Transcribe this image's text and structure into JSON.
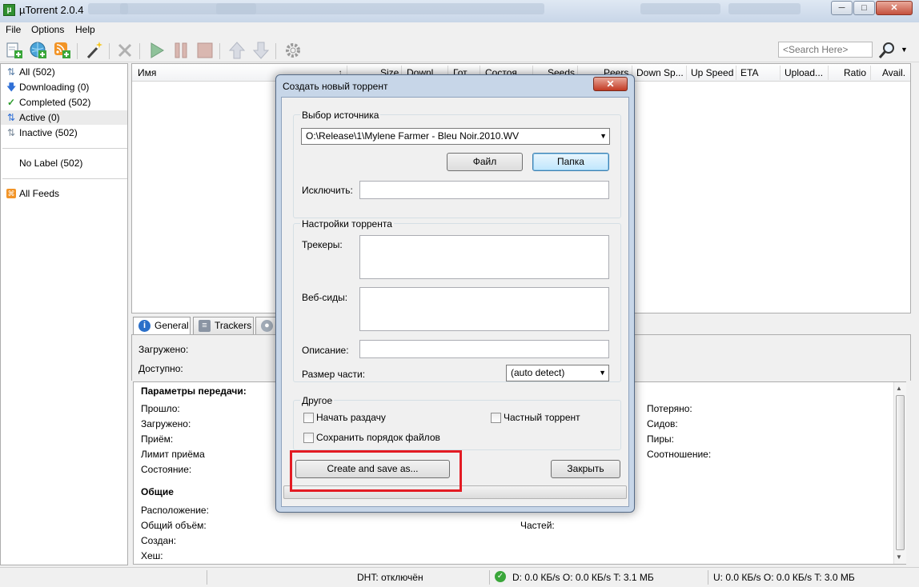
{
  "app": {
    "title": "µTorrent 2.0.4",
    "icon_glyph": "µ"
  },
  "menu": [
    "File",
    "Options",
    "Help"
  ],
  "toolbar": {
    "buttons": [
      "add-torrent-icon",
      "add-url-icon",
      "add-rss-icon",
      "create-torrent-wand-icon",
      "remove-icon",
      "start-icon",
      "pause-icon",
      "stop-icon",
      "move-up-icon",
      "move-down-icon",
      "preferences-gear-icon"
    ],
    "search_placeholder": "<Search Here>"
  },
  "sidebar": {
    "items": [
      {
        "label": "All (502)",
        "icon": "all-icon"
      },
      {
        "label": "Downloading (0)",
        "icon": "download-arrow-icon"
      },
      {
        "label": "Completed (502)",
        "icon": "checkmark-icon"
      },
      {
        "label": "Active (0)",
        "icon": "active-arrows-icon"
      },
      {
        "label": "Inactive (502)",
        "icon": "inactive-arrows-icon"
      }
    ],
    "labels_item": "No Label (502)",
    "feeds_item": "All Feeds"
  },
  "list": {
    "columns": [
      "Имя",
      "Size",
      "Downl...",
      "Гот...",
      "Состоя...",
      "Seeds",
      "Peers",
      "Down Sp...",
      "Up Speed",
      "ETA",
      "Upload...",
      "Ratio",
      "Avail."
    ]
  },
  "detail": {
    "tabs": [
      "General",
      "Trackers"
    ],
    "downloaded_label": "Загружено:",
    "available_label": "Доступно:",
    "transfer_header": "Параметры передачи:",
    "transfer_left": [
      "Прошло:",
      "Загружено:",
      "Приём:",
      "Лимит приёма",
      "Состояние:"
    ],
    "transfer_right": [
      "Потеряно:",
      "Сидов:",
      "Пиры:",
      "Соотношение:"
    ],
    "general_header": "Общие",
    "general_left": [
      "Расположение:",
      "Общий объём:",
      "Создан:",
      "Хеш:"
    ],
    "pieces_label": "Частей:"
  },
  "status": {
    "dht": "DHT: отключён",
    "download": "D: 0.0 КБ/s O: 0.0 КБ/s T: 3.1 МБ",
    "upload": "U: 0.0 КБ/s O: 0.0 КБ/s T: 3.0 МБ"
  },
  "dialog": {
    "title": "Создать новый торрент",
    "source_group": "Выбор источника",
    "source_path": "O:\\Release\\1\\Mylene Farmer - Bleu Noir.2010.WV",
    "file_button": "Файл",
    "folder_button": "Папка",
    "exclude_label": "Исключить:",
    "exclude_value": "",
    "settings_group": "Настройки торрента",
    "trackers_label": "Трекеры:",
    "trackers_value": "",
    "webseeds_label": "Веб-сиды:",
    "webseeds_value": "",
    "comment_label": "Описание:",
    "comment_value": "",
    "piece_size_label": "Размер части:",
    "piece_size_value": "(auto detect)",
    "other_group": "Другое",
    "start_seeding": "Начать раздачу",
    "private_torrent": "Частный торрент",
    "preserve_order": "Сохранить порядок файлов",
    "create_button": "Create and save as...",
    "close_button": "Закрыть",
    "start_seeding_checked": false,
    "private_torrent_checked": false,
    "preserve_order_checked": false
  },
  "colors": {
    "highlight": "#e31b23",
    "dialog_frame": "#c7d6e8",
    "ok_status": "#3aa63a"
  }
}
